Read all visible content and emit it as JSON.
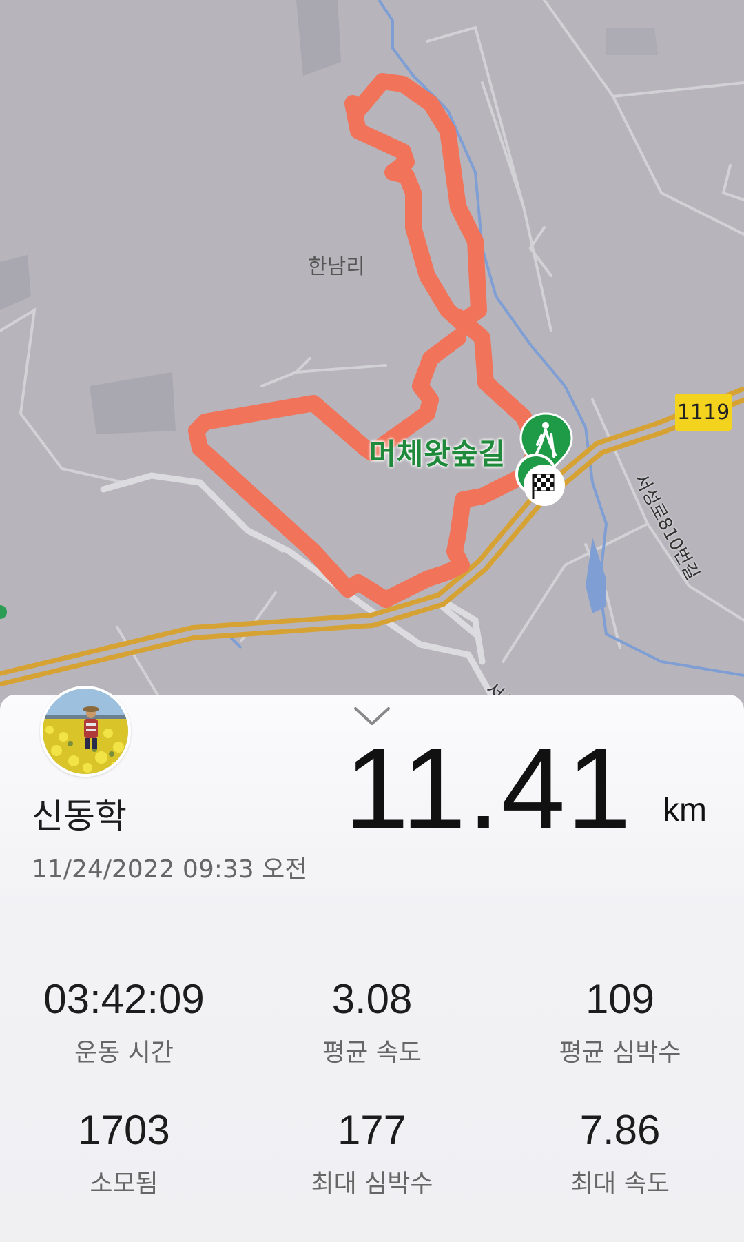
{
  "map": {
    "village_label": "한남리",
    "trail_label": "머체왓숲길",
    "route_badge": "1119",
    "road_label_1": "서성로810번길",
    "road_label_2": "서성",
    "route_color": "#f0735a"
  },
  "summary": {
    "user_name": "신동학",
    "date_time": "11/24/2022 09:33 오전",
    "distance": "11.41",
    "distance_unit": "km"
  },
  "stats": [
    {
      "value": "03:42:09",
      "label": "운동 시간"
    },
    {
      "value": "3.08",
      "label": "평균 속도"
    },
    {
      "value": "109",
      "label": "평균 심박수"
    },
    {
      "value": "1703",
      "label": "소모됨"
    },
    {
      "value": "177",
      "label": "최대 심박수"
    },
    {
      "value": "7.86",
      "label": "최대 속도"
    }
  ]
}
